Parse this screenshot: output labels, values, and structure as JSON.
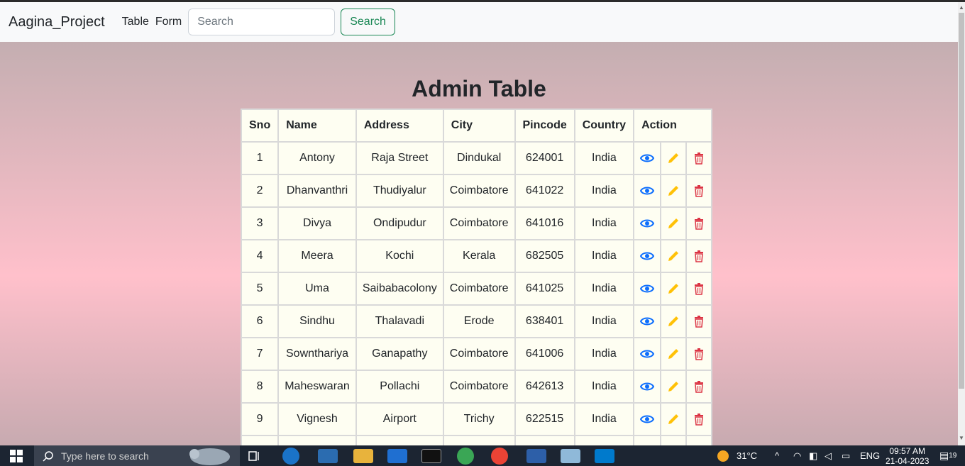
{
  "navbar": {
    "brand": "Aagina_Project",
    "links": [
      "Table",
      "Form"
    ],
    "search_placeholder": "Search",
    "search_button": "Search"
  },
  "page": {
    "title": "Admin Table"
  },
  "table": {
    "headers": [
      "Sno",
      "Name",
      "Address",
      "City",
      "Pincode",
      "Country",
      "Action"
    ],
    "rows": [
      {
        "sno": "1",
        "name": "Antony",
        "address": "Raja Street",
        "city": "Dindukal",
        "pincode": "624001",
        "country": "India"
      },
      {
        "sno": "2",
        "name": "Dhanvanthri",
        "address": "Thudiyalur",
        "city": "Coimbatore",
        "pincode": "641022",
        "country": "India"
      },
      {
        "sno": "3",
        "name": "Divya",
        "address": "Ondipudur",
        "city": "Coimbatore",
        "pincode": "641016",
        "country": "India"
      },
      {
        "sno": "4",
        "name": "Meera",
        "address": "Kochi",
        "city": "Kerala",
        "pincode": "682505",
        "country": "India"
      },
      {
        "sno": "5",
        "name": "Uma",
        "address": "Saibabacolony",
        "city": "Coimbatore",
        "pincode": "641025",
        "country": "India"
      },
      {
        "sno": "6",
        "name": "Sindhu",
        "address": "Thalavadi",
        "city": "Erode",
        "pincode": "638401",
        "country": "India"
      },
      {
        "sno": "7",
        "name": "Sownthariya",
        "address": "Ganapathy",
        "city": "Coimbatore",
        "pincode": "641006",
        "country": "India"
      },
      {
        "sno": "8",
        "name": "Maheswaran",
        "address": "Pollachi",
        "city": "Coimbatore",
        "pincode": "642613",
        "country": "India"
      },
      {
        "sno": "9",
        "name": "Vignesh",
        "address": "Airport",
        "city": "Trichy",
        "pincode": "622515",
        "country": "India"
      },
      {
        "sno": "",
        "name": "",
        "address": "",
        "city": "",
        "pincode": "",
        "country": ""
      }
    ],
    "action_icons": [
      "eye-icon",
      "pencil-icon",
      "trash-icon"
    ]
  },
  "colors": {
    "view": "#0d6efd",
    "edit": "#ffc107",
    "delete": "#dc3545",
    "search_button": "#198754"
  },
  "taskbar": {
    "search_placeholder": "Type here to search",
    "weather": "31°C",
    "language": "ENG",
    "time": "09:57 AM",
    "date": "21-04-2023",
    "notification_count": "19"
  }
}
